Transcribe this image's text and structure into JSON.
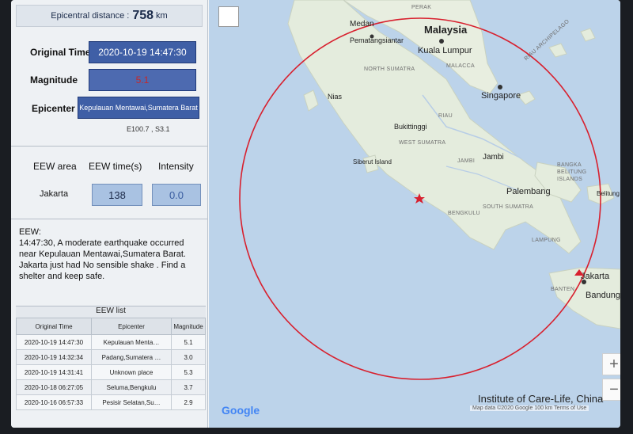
{
  "summary": {
    "distance_label": "Epicentral distance :",
    "distance_value": "758",
    "distance_unit": "km"
  },
  "event": {
    "time_label": "Original Time",
    "time_value": "2020-10-19 14:47:30",
    "magnitude_label": "Magnitude",
    "magnitude_value": "5.1",
    "epicenter_label": "Epicenter",
    "epicenter_value": "Kepulauan Mentawai,Sumatera Barat",
    "coords": "E100.7 , S3.1"
  },
  "eew": {
    "area_header": "EEW area",
    "time_header": "EEW time(s)",
    "intensity_header": "Intensity",
    "area_value": "Jakarta",
    "time_value": "138",
    "intensity_value": "0.0"
  },
  "message": {
    "label": "EEW:",
    "text": "14:47:30, A moderate earthquake occurred near Kepulauan Mentawai,Sumatera Barat. Jakarta just had No sensible shake . Find a shelter and keep safe."
  },
  "eew_list": {
    "title": "EEW list",
    "columns": [
      "Original Time",
      "Epicenter",
      "Magnitude"
    ],
    "rows": [
      {
        "time": "2020-10-19 14:47:30",
        "epicenter": "Kepulauan Menta…",
        "magnitude": "5.1"
      },
      {
        "time": "2020-10-19 14:32:34",
        "epicenter": "Padang,Sumatera …",
        "magnitude": "3.0"
      },
      {
        "time": "2020-10-19 14:31:41",
        "epicenter": "Unknown place",
        "magnitude": "5.3"
      },
      {
        "time": "2020-10-18 06:27:05",
        "epicenter": "Seluma,Bengkulu",
        "magnitude": "3.7"
      },
      {
        "time": "2020-10-16 06:57:33",
        "epicenter": "Pesisir Selatan,Su…",
        "magnitude": "2.9"
      }
    ]
  },
  "map": {
    "labels": {
      "medan": "Medan",
      "pematang": "Pematangsiantar",
      "malaysia": "Malaysia",
      "kl": "Kuala Lumpur",
      "malacca": "MALACCA",
      "north_sumatra": "NORTH SUMATRA",
      "nias": "Nias",
      "singapore": "Singapore",
      "riau_arch": "RIAU ARCHIPELAGO",
      "riau": "RIAU",
      "bukittinggi": "Bukittinggi",
      "west_sumatra": "WEST SUMATRA",
      "siberut": "Siberut Island",
      "jambi_region": "JAMBI",
      "jambi": "Jambi",
      "bangka": "BANGKA BELITUNG ISLANDS",
      "palembang": "Palembang",
      "belitung": "Belitung",
      "bengkulu": "BENGKULU",
      "south_sumatra": "SOUTH SUMATRA",
      "lampung": "LAMPUNG",
      "jakarta": "Jakarta",
      "banten": "BANTEN",
      "bandung": "Bandung",
      "perak": "PERAK"
    },
    "zoom_in": "+",
    "zoom_out": "−",
    "brand": "Google",
    "attribution": "Map data ©2020 Google   100 km         Terms of Use",
    "footer": "Institute of Care-Life, China",
    "circle_color": "#d8202e",
    "sea_color": "#bcd3ea",
    "land_color": "#e9efe3"
  }
}
